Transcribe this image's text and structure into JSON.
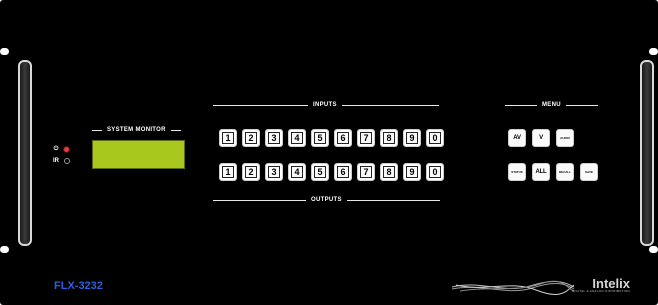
{
  "device": {
    "model": "FLX-3232",
    "brand": "Intelix",
    "brand_tagline": "DIGITAL & ANALOG DISTRIBUTION"
  },
  "status_leds": [
    {
      "label": "⏻",
      "name": "power-led"
    },
    {
      "label": "IR",
      "name": "ir-led"
    }
  ],
  "system_monitor": {
    "title": "SYSTEM MONITOR",
    "display_text": ""
  },
  "inputs": {
    "title": "INPUTS",
    "buttons": [
      "1",
      "2",
      "3",
      "4",
      "5",
      "6",
      "7",
      "8",
      "9",
      "0"
    ]
  },
  "outputs": {
    "title": "OUTPUTS",
    "buttons": [
      "1",
      "2",
      "3",
      "4",
      "5",
      "6",
      "7",
      "8",
      "9",
      "0"
    ]
  },
  "menu": {
    "title": "MENU",
    "row1": [
      "AV",
      "V",
      "AUDIO"
    ],
    "row2": [
      "STATUS",
      "ALL",
      "RECALL",
      "SAVE"
    ]
  }
}
